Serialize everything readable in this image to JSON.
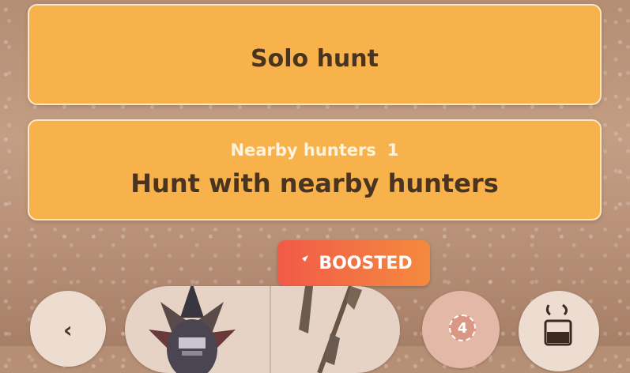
{
  "solo": {
    "label": "Solo hunt"
  },
  "nearby": {
    "sub_label": "Nearby hunters",
    "count": "1",
    "label": "Hunt with nearby hunters"
  },
  "boost": {
    "label": "BOOSTED",
    "icon": "boost-arrow-icon"
  },
  "party": {
    "size": "4"
  },
  "colors": {
    "button": "#f7b24c",
    "boost_start": "#f15a48",
    "boost_end": "#f48a3e"
  }
}
